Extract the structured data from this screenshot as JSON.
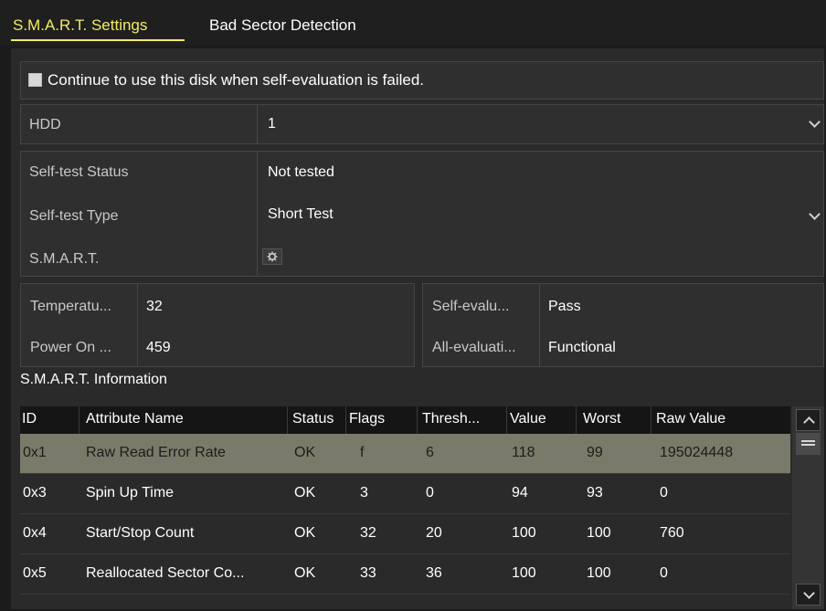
{
  "tabs": [
    {
      "label": "S.M.A.R.T. Settings",
      "active": true
    },
    {
      "label": "Bad Sector Detection",
      "active": false
    }
  ],
  "continue_option": {
    "label": "Continue to use this disk when self-evaluation is failed.",
    "checked": false
  },
  "fields": {
    "hdd": {
      "label": "HDD",
      "value": "1"
    },
    "self_test_status": {
      "label": "Self-test Status",
      "value": "Not tested"
    },
    "self_test_type": {
      "label": "Self-test Type",
      "value": "Short Test"
    },
    "smart": {
      "label": "S.M.A.R.T.",
      "button_icon": "gear-icon"
    }
  },
  "status": {
    "temperature": {
      "label": "Temperatu...",
      "value": "32"
    },
    "power_on": {
      "label": "Power On ...",
      "value": "459"
    },
    "self_evaluation": {
      "label": "Self-evalu...",
      "value": "Pass"
    },
    "all_evaluation": {
      "label": "All-evaluati...",
      "value": "Functional"
    }
  },
  "smart_info": {
    "title": "S.M.A.R.T. Information",
    "columns": [
      "ID",
      "Attribute Name",
      "Status",
      "Flags",
      "Thresh...",
      "Value",
      "Worst",
      "Raw Value"
    ],
    "rows": [
      {
        "id": "0x1",
        "name": "Raw Read Error Rate",
        "status": "OK",
        "flags": "f",
        "threshold": "6",
        "value": "118",
        "worst": "99",
        "raw": "195024448",
        "selected": true
      },
      {
        "id": "0x3",
        "name": "Spin Up Time",
        "status": "OK",
        "flags": "3",
        "threshold": "0",
        "value": "94",
        "worst": "93",
        "raw": "0",
        "selected": false
      },
      {
        "id": "0x4",
        "name": "Start/Stop Count",
        "status": "OK",
        "flags": "32",
        "threshold": "20",
        "value": "100",
        "worst": "100",
        "raw": "760",
        "selected": false
      },
      {
        "id": "0x5",
        "name": "Reallocated Sector Co...",
        "status": "OK",
        "flags": "33",
        "threshold": "36",
        "value": "100",
        "worst": "100",
        "raw": "0",
        "selected": false
      }
    ]
  },
  "colors": {
    "accent": "#f3ea62",
    "selected_row": "#7a7a6a",
    "background": "#1b1b1b"
  }
}
